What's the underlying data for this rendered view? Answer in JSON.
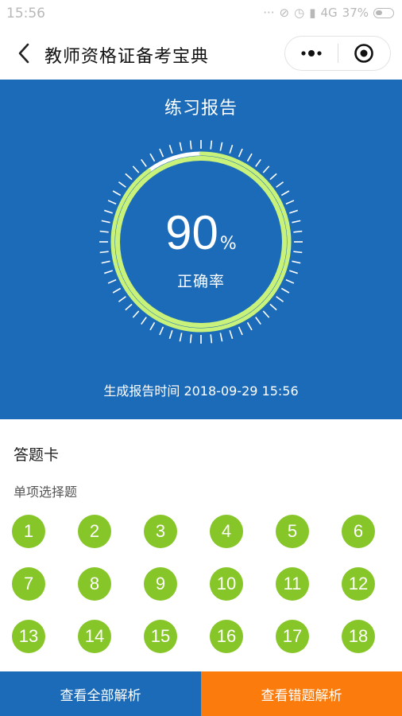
{
  "status_bar": {
    "time": "15:56",
    "network": "4G",
    "battery": "37%",
    "icons": [
      "dots-icon",
      "mute-icon",
      "alarm-icon",
      "signal-icon",
      "battery-icon"
    ]
  },
  "nav": {
    "title": "教师资格证备考宝典",
    "back_icon": "chevron-left-icon",
    "more_icon": "more-dots-icon",
    "close_icon": "target-circle-icon"
  },
  "report": {
    "title": "练习报告",
    "accuracy": 90,
    "accuracy_text": "90",
    "accuracy_unit": "%",
    "accuracy_label": "正确率",
    "generated_prefix": "生成报告时间",
    "generated_time": "2018-09-29 15:56",
    "generated_full": "生成报告时间 2018-09-29 15:56",
    "colors": {
      "background": "#1c6bb8",
      "progress": "#c8f27a",
      "remainder": "#ffffff"
    }
  },
  "answer_card": {
    "title": "答题卡",
    "section": "单项选择题",
    "questions": [
      "1",
      "2",
      "3",
      "4",
      "5",
      "6",
      "7",
      "8",
      "9",
      "10",
      "11",
      "12",
      "13",
      "14",
      "15",
      "16",
      "17",
      "18"
    ],
    "correct_color": "#86c628"
  },
  "actions": {
    "view_all": "查看全部解析",
    "view_wrong": "查看错题解析",
    "colors": {
      "view_all": "#1c6bb8",
      "view_wrong": "#fb7c0c"
    }
  }
}
